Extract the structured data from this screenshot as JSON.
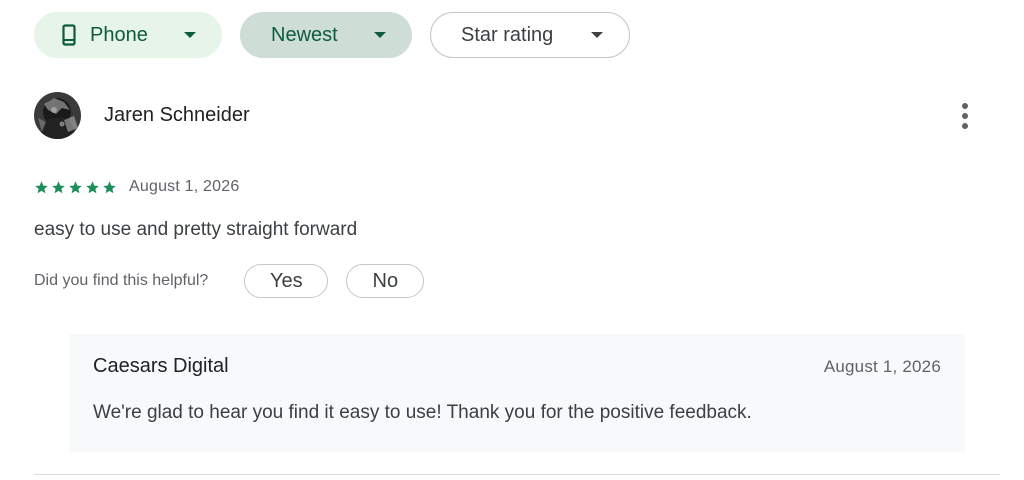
{
  "filters": {
    "device": {
      "label": "Phone",
      "icon": "phone-icon"
    },
    "sort": {
      "label": "Newest"
    },
    "rating": {
      "label": "Star rating"
    }
  },
  "review": {
    "author": "Jaren Schneider",
    "avatar": "avatar",
    "rating": 5,
    "date": "August 1, 2026",
    "text": "easy to use and pretty straight forward",
    "helpful_question": "Did you find this helpful?",
    "yes_label": "Yes",
    "no_label": "No"
  },
  "reply": {
    "author": "Caesars Digital",
    "date": "August 1, 2026",
    "text": "We're glad to hear you find it easy to use! Thank you for the positive feedback."
  },
  "colors": {
    "accent_green": "#0d5c3b",
    "star_green": "#1e8e5a",
    "chip_light": "#e6f4ea",
    "chip_selected": "#ceddd6"
  }
}
